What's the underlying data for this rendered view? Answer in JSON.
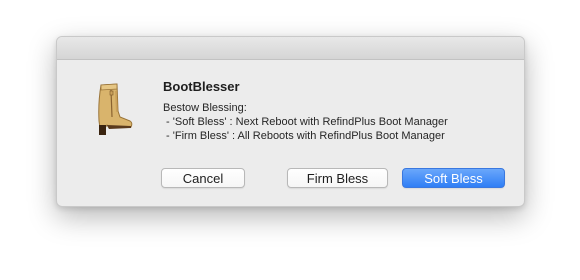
{
  "dialog": {
    "title": "BootBlesser",
    "message": "Bestow Blessing:\n - 'Soft Bless' : Next Reboot with RefindPlus Boot Manager\n - 'Firm Bless' : All Reboots with RefindPlus Boot Manager",
    "icon": "boot-icon"
  },
  "buttons": {
    "cancel_label": "Cancel",
    "firm_label": "Firm Bless",
    "soft_label": "Soft Bless"
  },
  "colors": {
    "default_button": "#3c86f7",
    "dialog_background": "#ececec"
  }
}
